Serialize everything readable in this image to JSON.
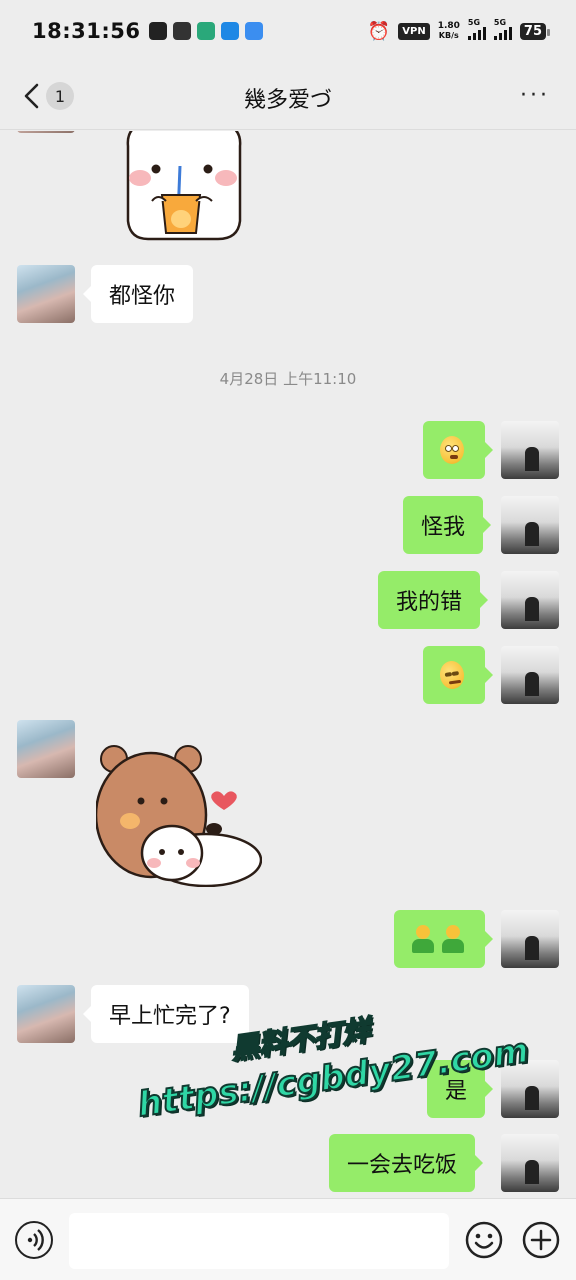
{
  "status_bar": {
    "time": "18:31:56",
    "vpn": "VPN",
    "speed_value": "1.80",
    "speed_unit": "KB/s",
    "network1": "5G",
    "network2": "5G",
    "battery": "75"
  },
  "header": {
    "unread_count": "1",
    "title": "幾多爱づ",
    "more": "···"
  },
  "messages": {
    "m1": "都怪你",
    "timestamp": "4月28日 上午11:10",
    "m3": "怪我",
    "m4": "我的错",
    "m8": "早上忙完了?",
    "m9": "是",
    "m10": "一会去吃饭"
  },
  "watermark": {
    "line1": "黑料不打烊",
    "line2": "https://cgbdy27.com"
  },
  "icons": {
    "back": "chevron-left-icon",
    "voice": "voice-icon",
    "emoji": "smiley-icon",
    "plus": "plus-icon",
    "emoji_flushed": "flushed-face-emoji",
    "emoji_sly": "smirk-face-emoji",
    "emoji_man": "man-emoji"
  },
  "colors": {
    "incoming_bubble": "#ffffff",
    "outgoing_bubble": "#95ec69",
    "background": "#ededed",
    "watermark": "#2fd7a5"
  }
}
